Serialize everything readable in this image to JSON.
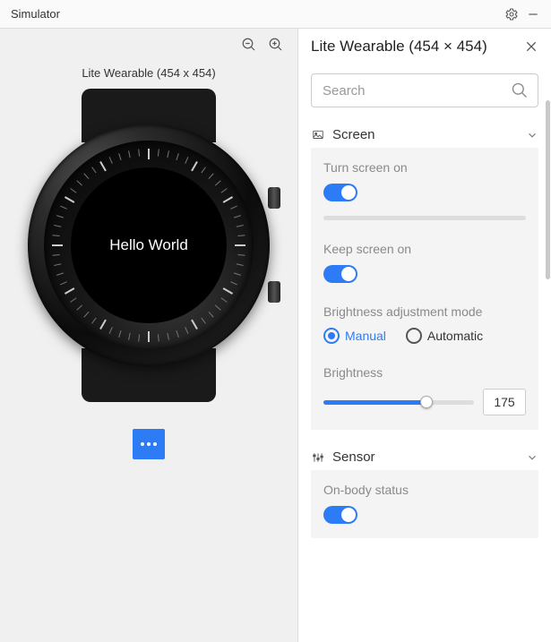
{
  "titlebar": {
    "title": "Simulator"
  },
  "device_label": "Lite Wearable (454 x 454)",
  "screen_text": "Hello World",
  "panel": {
    "title": "Lite Wearable (454 × 454)",
    "search_placeholder": "Search"
  },
  "sections": {
    "screen": {
      "label": "Screen",
      "turn_on_label": "Turn screen on",
      "turn_on_value": true,
      "keep_on_label": "Keep screen on",
      "keep_on_value": true,
      "brightness_mode_label": "Brightness adjustment mode",
      "mode_manual": "Manual",
      "mode_automatic": "Automatic",
      "mode_selected": "manual",
      "brightness_label": "Brightness",
      "brightness_value": "175",
      "brightness_max": 255
    },
    "sensor": {
      "label": "Sensor",
      "onbody_label": "On-body status",
      "onbody_value": true
    }
  },
  "colors": {
    "accent": "#2d7cf6"
  }
}
